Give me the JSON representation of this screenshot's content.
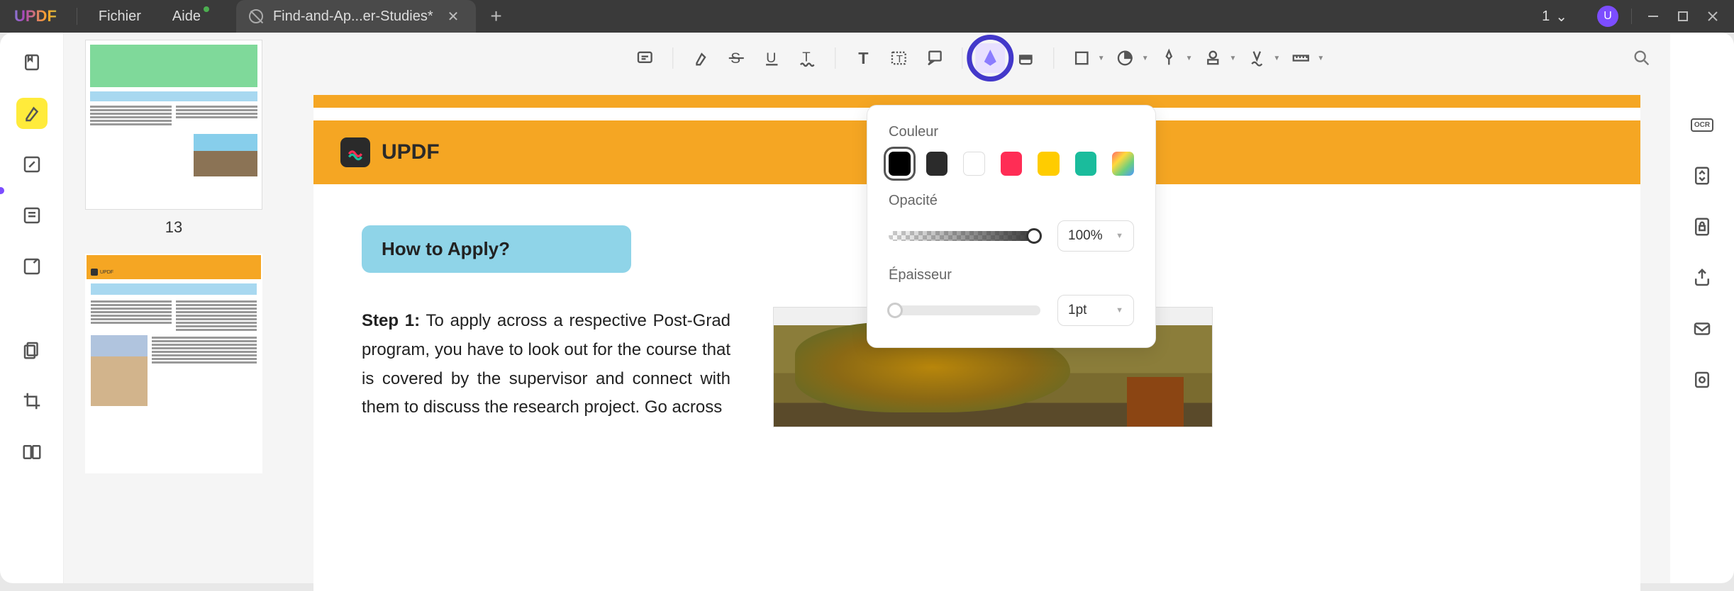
{
  "app": {
    "name": "UPDF",
    "avatar_letter": "U",
    "page_indicator": "1"
  },
  "menu": {
    "file": "Fichier",
    "help": "Aide"
  },
  "tab": {
    "title": "Find-and-Ap...er-Studies*"
  },
  "thumbnails": {
    "page13_label": "13"
  },
  "toolbar_icons": [
    "comment",
    "highlight",
    "strikethrough",
    "underline",
    "squiggly",
    "text-style",
    "text",
    "textbox",
    "callout",
    "pencil",
    "eraser",
    "shape",
    "color-fill",
    "pin",
    "stamp",
    "signature",
    "measure"
  ],
  "popover": {
    "color_label": "Couleur",
    "colors": [
      "#000000",
      "#2b2b2b",
      "#ffffff",
      "#ff2d55",
      "#ffcc00",
      "#1abc9c",
      "gradient"
    ],
    "selected_color_index": 0,
    "opacity_label": "Opacité",
    "opacity_value": "100%",
    "thickness_label": "Épaisseur",
    "thickness_value": "1pt"
  },
  "document": {
    "brand": "UPDF",
    "section_title": "How to Apply?",
    "step_label": "Step 1:",
    "step_text": "To apply across a respective Post-Grad program, you have to look out for the course that is covered by the supervisor and connect with them to discuss the research project. Go across"
  }
}
